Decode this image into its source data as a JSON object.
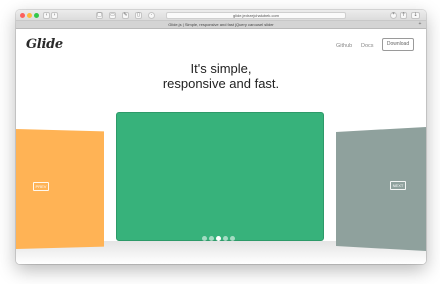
{
  "browser": {
    "address": "glide.jedrzejchalubek.com",
    "tab_title": "Glide.js | Simple, responsive and fast jQuery carousel slider",
    "back_icon": "chevron-left-icon",
    "forward_icon": "chevron-right-icon",
    "new_tab": "+"
  },
  "site": {
    "logo": "Glide",
    "nav": {
      "github": "Github",
      "docs": "Docs",
      "download": "Download"
    },
    "headline_line1": "It's simple,",
    "headline_line2": "responsive and fast."
  },
  "carousel": {
    "prev_label": "PREV",
    "next_label": "NEXT",
    "slide_colors": [
      "#ffb355",
      "#37b27b",
      "#8fa19d"
    ],
    "bullet_count": 5,
    "active_bullet": 2
  }
}
